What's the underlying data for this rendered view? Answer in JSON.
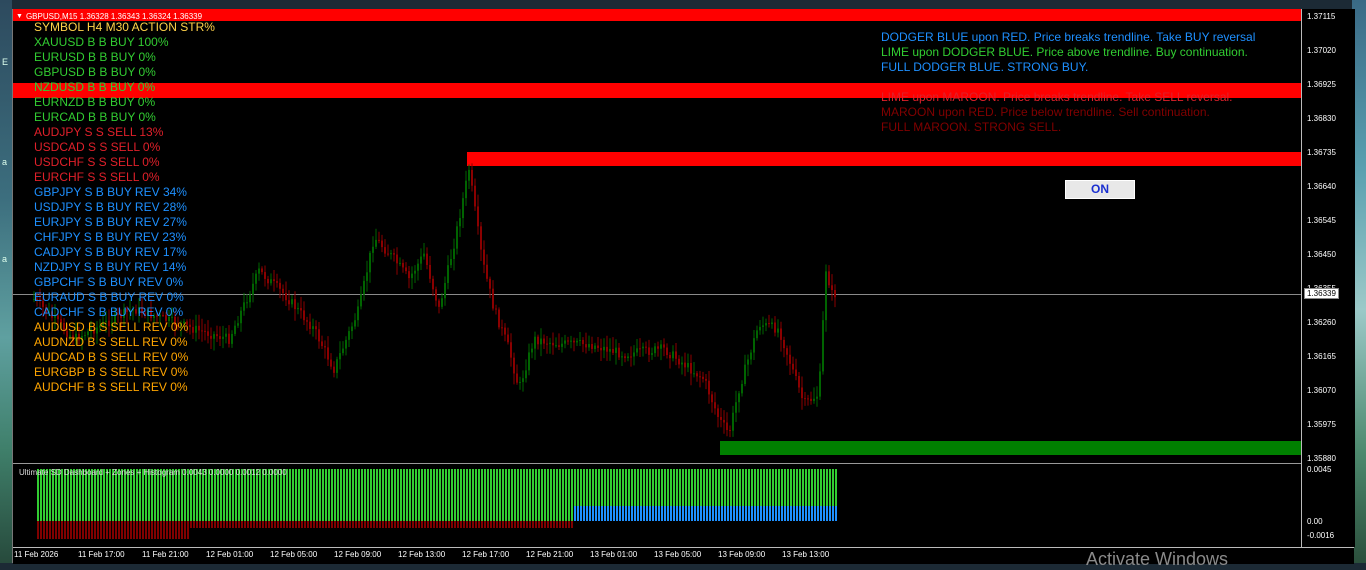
{
  "window": {
    "title": "GBPUSD,M15  1.36328 1.36343 1.36324 1.36339"
  },
  "dashboard": {
    "header": "SYMBOL H4 M30 ACTION STR%",
    "rows": [
      {
        "text": "XAUUSD B B BUY 100%",
        "color": "#32cd32"
      },
      {
        "text": "EURUSD B B BUY 0%",
        "color": "#32cd32"
      },
      {
        "text": "GBPUSD B B BUY 0%",
        "color": "#32cd32"
      },
      {
        "text": "NZDUSD B B BUY 0%",
        "color": "#32cd32"
      },
      {
        "text": "EURNZD B B BUY 0%",
        "color": "#32cd32"
      },
      {
        "text": "EURCAD B B BUY 0%",
        "color": "#32cd32"
      },
      {
        "text": "AUDJPY S S SELL 13%",
        "color": "#e0202a"
      },
      {
        "text": "USDCAD S S SELL 0%",
        "color": "#e0202a"
      },
      {
        "text": "USDCHF S S SELL 0%",
        "color": "#e0202a"
      },
      {
        "text": "EURCHF S S SELL 0%",
        "color": "#e0202a"
      },
      {
        "text": "GBPJPY S B BUY REV 34%",
        "color": "#1e90ff"
      },
      {
        "text": "USDJPY S B BUY REV 28%",
        "color": "#1e90ff"
      },
      {
        "text": "EURJPY S B BUY REV 27%",
        "color": "#1e90ff"
      },
      {
        "text": "CHFJPY S B BUY REV 23%",
        "color": "#1e90ff"
      },
      {
        "text": "CADJPY S B BUY REV 17%",
        "color": "#1e90ff"
      },
      {
        "text": "NZDJPY S B BUY REV 14%",
        "color": "#1e90ff"
      },
      {
        "text": "GBPCHF S B BUY REV 0%",
        "color": "#1e90ff"
      },
      {
        "text": "EURAUD S B BUY REV 0%",
        "color": "#1e90ff"
      },
      {
        "text": "CADCHF S B BUY REV 0%",
        "color": "#1e90ff"
      },
      {
        "text": "AUDUSD B S SELL REV 0%",
        "color": "#ffa500"
      },
      {
        "text": "AUDNZD B S SELL REV 0%",
        "color": "#ffa500"
      },
      {
        "text": "AUDCAD B S SELL REV 0%",
        "color": "#ffa500"
      },
      {
        "text": "EURGBP B S SELL REV 0%",
        "color": "#ffa500"
      },
      {
        "text": "AUDCHF B S SELL REV 0%",
        "color": "#ffa500"
      }
    ]
  },
  "legend": [
    {
      "text": "DODGER BLUE upon RED. Price breaks trendline. Take BUY reversal",
      "color": "#1e90ff"
    },
    {
      "text": "LIME upon DODGER BLUE. Price above trendline. Buy continuation.",
      "color": "#32cd32"
    },
    {
      "text": "FULL DODGER BLUE. STRONG BUY.",
      "color": "#1e90ff"
    },
    {
      "text": "",
      "color": "#000000"
    },
    {
      "text": "LIME upon MAROON. Price breaks trendline. Take SELL reversal.",
      "color": "#e0202a"
    },
    {
      "text": "MAROON upon RED. Price below trendline. Sell continuation.",
      "color": "#800000"
    },
    {
      "text": "FULL MAROON. STRONG SELL.",
      "color": "#800000"
    }
  ],
  "on_button": {
    "label": "ON"
  },
  "price_axis": {
    "ticks": [
      "1.37115",
      "1.37020",
      "1.36925",
      "1.36830",
      "1.36735",
      "1.36640",
      "1.36545",
      "1.36450",
      "1.36355",
      "1.36260",
      "1.36165",
      "1.36070",
      "1.35975",
      "1.35880"
    ],
    "current_price": "1.36339"
  },
  "indicator": {
    "label": "Ultimate SD Dashboard + Zones + Histogram 0.0043 0.0000 0.0012 0.0000",
    "ticks": [
      "0.0045",
      "0.00",
      "-0.0016"
    ]
  },
  "time_axis": {
    "labels": [
      "11 Feb 2026",
      "11 Feb 17:00",
      "11 Feb 21:00",
      "12 Feb 01:00",
      "12 Feb 05:00",
      "12 Feb 09:00",
      "12 Feb 13:00",
      "12 Feb 17:00",
      "12 Feb 21:00",
      "13 Feb 01:00",
      "13 Feb 05:00",
      "13 Feb 09:00",
      "13 Feb 13:00"
    ]
  },
  "colors": {
    "zone_red": "#ff0000",
    "zone_green": "#008000",
    "bear_candle": "#8b0000",
    "bull_candle": "#006400",
    "hist_lime": "#32cd32",
    "hist_blue": "#1e90ff",
    "hist_maroon": "#800000"
  },
  "watermark": "Activate Windows"
}
